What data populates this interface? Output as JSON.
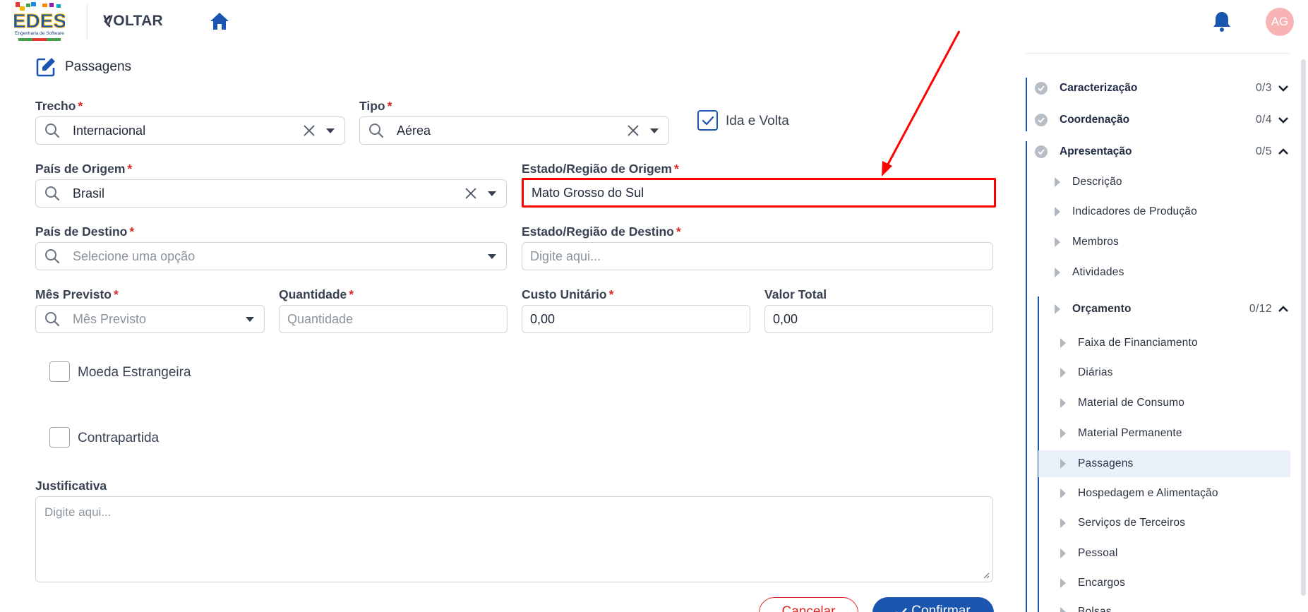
{
  "header": {
    "logo_text": "EDES",
    "logo_subtext": "Engenharia de Software",
    "back_label": "VOLTAR",
    "avatar_initials": "AG"
  },
  "form": {
    "section_title": "Passagens",
    "trecho": {
      "label": "Trecho",
      "value": "Internacional"
    },
    "tipo": {
      "label": "Tipo",
      "value": "Aérea"
    },
    "ida_volta": {
      "label": "Ida e Volta",
      "checked": true
    },
    "pais_origem": {
      "label": "País de Origem",
      "value": "Brasil"
    },
    "estado_origem": {
      "label": "Estado/Região de Origem",
      "value": "Mato Grosso do Sul"
    },
    "pais_destino": {
      "label": "País de Destino",
      "placeholder": "Selecione uma opção"
    },
    "estado_destino": {
      "label": "Estado/Região de Destino",
      "placeholder": "Digite aqui..."
    },
    "mes_previsto": {
      "label": "Mês Previsto",
      "placeholder": "Mês Previsto"
    },
    "quantidade": {
      "label": "Quantidade",
      "placeholder": "Quantidade"
    },
    "custo_unitario": {
      "label": "Custo Unitário",
      "value": "0,00"
    },
    "valor_total": {
      "label": "Valor Total",
      "value": "0,00"
    },
    "moeda_estrangeira": {
      "label": "Moeda Estrangeira",
      "checked": false
    },
    "contrapartida": {
      "label": "Contrapartida",
      "checked": false
    },
    "justificativa": {
      "label": "Justificativa",
      "placeholder": "Digite aqui..."
    },
    "required_mark": "*",
    "cancel_label": "Cancelar",
    "confirm_label": "Confirmar"
  },
  "sidebar": {
    "sections": [
      {
        "name": "Caracterização",
        "count": "0/3",
        "expanded": false
      },
      {
        "name": "Coordenação",
        "count": "0/4",
        "expanded": false
      },
      {
        "name": "Apresentação",
        "count": "0/5",
        "expanded": true
      }
    ],
    "apresentacao_items": [
      "Descrição",
      "Indicadores de Produção",
      "Membros",
      "Atividades"
    ],
    "orcamento": {
      "name": "Orçamento",
      "count": "0/12",
      "expanded": true
    },
    "orcamento_items": [
      "Faixa de Financiamento",
      "Diárias",
      "Material de Consumo",
      "Material Permanente",
      "Passagens",
      "Hospedagem e Alimentação",
      "Serviços de Terceiros",
      "Pessoal",
      "Encargos",
      "Bolsas"
    ],
    "active_item": "Passagens"
  },
  "colors": {
    "primary": "#1a56b0",
    "danger": "#dc2626",
    "annotation": "#ff0000",
    "avatar_bg": "#f8b4b4",
    "active_bg": "#eaf1fb"
  }
}
